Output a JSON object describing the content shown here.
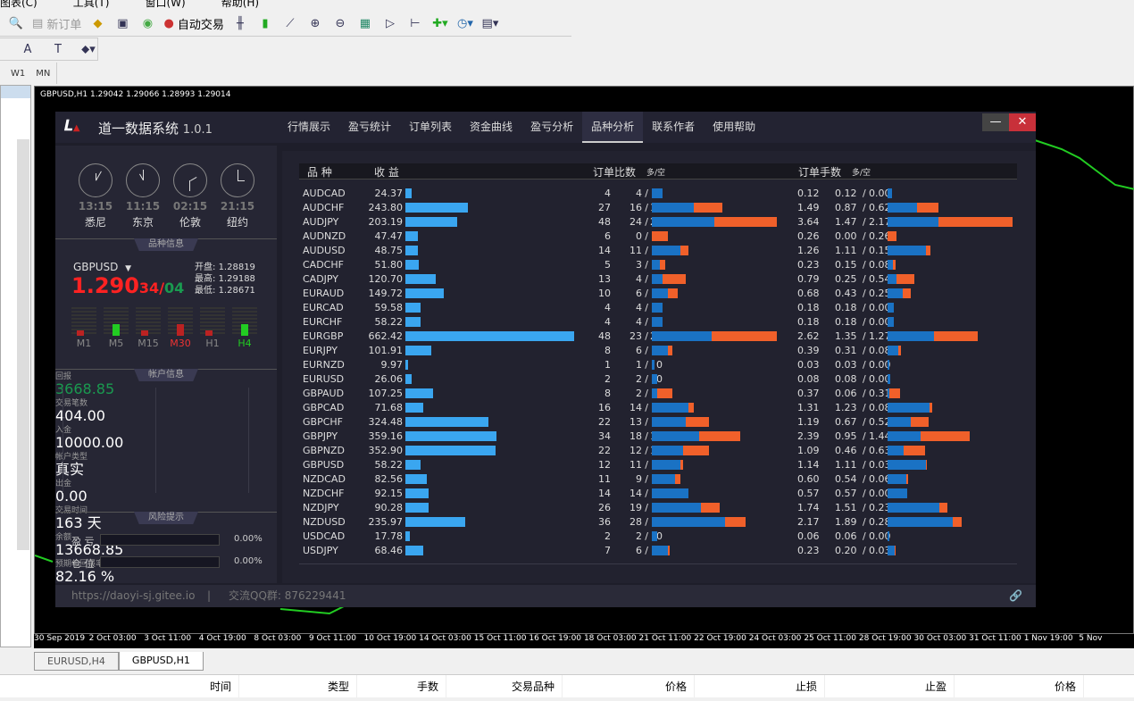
{
  "menu": [
    "图表(C)",
    "工具(T)",
    "窗口(W)",
    "帮助(H)"
  ],
  "toolbar": {
    "new_order": "新订单",
    "auto_trade": "自动交易",
    "text_tool": "A",
    "text_label_tool": "T",
    "timeframes": [
      "W1",
      "MN"
    ]
  },
  "chart": {
    "title": "GBPUSD,H1  1.29042 1.29066 1.28993 1.29014",
    "xaxis": [
      "30 Sep 2019",
      "2 Oct 03:00",
      "3 Oct 11:00",
      "4 Oct 19:00",
      "8 Oct 03:00",
      "9 Oct 11:00",
      "10 Oct 19:00",
      "14 Oct 03:00",
      "15 Oct 11:00",
      "16 Oct 19:00",
      "18 Oct 03:00",
      "21 Oct 11:00",
      "22 Oct 19:00",
      "24 Oct 03:00",
      "25 Oct 11:00",
      "28 Oct 19:00",
      "30 Oct 03:00",
      "31 Oct 11:00",
      "1 Nov 19:00",
      "5 Nov"
    ]
  },
  "chart_tabs": [
    "EURUSD,H4",
    "GBPUSD,H1"
  ],
  "terminal_columns": [
    "时间",
    "类型",
    "手数",
    "交易品种",
    "价格",
    "止损",
    "止盈",
    "价格"
  ],
  "app": {
    "title": "道一数据系统",
    "version": "1.0.1",
    "logo": "道一",
    "tabs": [
      "行情展示",
      "盈亏统计",
      "订单列表",
      "资金曲线",
      "盈亏分析",
      "品种分析",
      "联系作者",
      "使用帮助"
    ],
    "active_tab": "品种分析",
    "minimize": "—",
    "close": "✕"
  },
  "clocks": [
    {
      "time": "13:15",
      "city": "悉尼"
    },
    {
      "time": "11:15",
      "city": "东京"
    },
    {
      "time": "02:15",
      "city": "伦敦"
    },
    {
      "time": "21:15",
      "city": "纽约"
    }
  ],
  "symbol_info": {
    "header": "品种信息",
    "symbol": "GBPUSD",
    "price_main": "1.290",
    "price_mid": "34",
    "price_sep": "/",
    "price_end": "04",
    "open_label": "开盘:",
    "open": "1.28819",
    "high_label": "最高:",
    "high": "1.29188",
    "low_label": "最低:",
    "low": "1.28671",
    "timeframes": [
      "M1",
      "M5",
      "M15",
      "M30",
      "H1",
      "H4"
    ]
  },
  "account": {
    "header": "帐户信息",
    "items": [
      {
        "label": "回报",
        "value": "3668.85"
      },
      {
        "label": "交易笔数",
        "value": "404.00"
      },
      {
        "label": "入金",
        "value": "10000.00"
      },
      {
        "label": "帐户类型",
        "value": "真实"
      },
      {
        "label": "出金",
        "value": "0.00"
      },
      {
        "label": "交易时间",
        "value": "163 天"
      },
      {
        "label": "余额",
        "value": "13668.85"
      },
      {
        "label": "预期年回报率",
        "value": "82.16 %"
      }
    ]
  },
  "risk": {
    "header": "风险提示",
    "pl_label": "盈 亏",
    "pl_value": "0.00%",
    "pl_fraction": 0,
    "pos_label": "仓 位",
    "pos_value": "0.00%",
    "pos_fraction": 0
  },
  "footer": {
    "url": "https://daoyi-sj.gitee.io",
    "sep": "|",
    "qq": "交流QQ群: 876229441"
  },
  "table": {
    "headers": {
      "symbol": "品 种",
      "profit": "收 益",
      "orders": "订单比数",
      "orders_sub": "多/空",
      "lots": "订单手数",
      "lots_sub": "多/空"
    },
    "colors": {
      "profit": "#3aa6f0",
      "long": "#1a72c4",
      "short": "#f0602a"
    },
    "rows": [
      [
        "AUDCAD",
        "24.37",
        4,
        4,
        0,
        "0.12",
        0.12,
        0.0
      ],
      [
        "AUDCHF",
        "243.80",
        27,
        16,
        11,
        "1.49",
        0.87,
        0.62
      ],
      [
        "AUDJPY",
        "203.19",
        48,
        24,
        24,
        "3.64",
        1.47,
        2.17
      ],
      [
        "AUDNZD",
        "47.47",
        6,
        0,
        6,
        "0.26",
        0.0,
        0.26
      ],
      [
        "AUDUSD",
        "48.75",
        14,
        11,
        3,
        "1.26",
        1.11,
        0.15
      ],
      [
        "CADCHF",
        "51.80",
        5,
        3,
        2,
        "0.23",
        0.15,
        0.08
      ],
      [
        "CADJPY",
        "120.70",
        13,
        4,
        9,
        "0.79",
        0.25,
        0.54
      ],
      [
        "EURAUD",
        "149.72",
        10,
        6,
        4,
        "0.68",
        0.43,
        0.25
      ],
      [
        "EURCAD",
        "59.58",
        4,
        4,
        0,
        "0.18",
        0.18,
        0.0
      ],
      [
        "EURCHF",
        "58.22",
        4,
        4,
        0,
        "0.18",
        0.18,
        0.0
      ],
      [
        "EURGBP",
        "662.42",
        48,
        23,
        25,
        "2.62",
        1.35,
        1.27
      ],
      [
        "EURJPY",
        "101.91",
        8,
        6,
        2,
        "0.39",
        0.31,
        0.08
      ],
      [
        "EURNZD",
        "9.97",
        1,
        1,
        0,
        "0.03",
        0.03,
        0.0
      ],
      [
        "EURUSD",
        "26.06",
        2,
        2,
        0,
        "0.08",
        0.08,
        0.0
      ],
      [
        "GBPAUD",
        "107.25",
        8,
        2,
        6,
        "0.37",
        0.06,
        0.31
      ],
      [
        "GBPCAD",
        "71.68",
        16,
        14,
        2,
        "1.31",
        1.23,
        0.08
      ],
      [
        "GBPCHF",
        "324.48",
        22,
        13,
        9,
        "1.19",
        0.67,
        0.52
      ],
      [
        "GBPJPY",
        "359.16",
        34,
        18,
        16,
        "2.39",
        0.95,
        1.44
      ],
      [
        "GBPNZD",
        "352.90",
        22,
        12,
        10,
        "1.09",
        0.46,
        0.63
      ],
      [
        "GBPUSD",
        "58.22",
        12,
        11,
        1,
        "1.14",
        1.11,
        0.03
      ],
      [
        "NZDCAD",
        "82.56",
        11,
        9,
        2,
        "0.60",
        0.54,
        0.06
      ],
      [
        "NZDCHF",
        "92.15",
        14,
        14,
        0,
        "0.57",
        0.57,
        0.0
      ],
      [
        "NZDJPY",
        "90.28",
        26,
        19,
        7,
        "1.74",
        1.51,
        0.23
      ],
      [
        "NZDUSD",
        "235.97",
        36,
        28,
        8,
        "2.17",
        1.89,
        0.28
      ],
      [
        "USDCAD",
        "17.78",
        2,
        2,
        0,
        "0.06",
        0.06,
        0.0
      ],
      [
        "USDJPY",
        "68.46",
        7,
        6,
        1,
        "0.23",
        0.2,
        0.03
      ]
    ]
  }
}
